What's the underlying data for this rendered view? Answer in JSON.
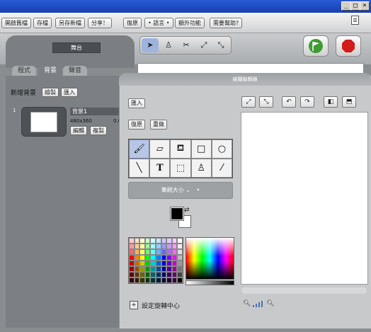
{
  "menubar": {
    "buttons": [
      "開啟舊檔",
      "存檔",
      "另存新檔",
      "分享！",
      "復原",
      "• 語言 •",
      "額外功能",
      "需要幫助?"
    ]
  },
  "stage": {
    "name": "舞台",
    "tabs": [
      "程式",
      "背景",
      "聲音"
    ],
    "selected_tab": "背景"
  },
  "backdrops": {
    "new_label": "新增背景",
    "paint_button": "繪製",
    "import_button": "匯入",
    "items": [
      {
        "index": "1",
        "name": "背景1",
        "size": "480x360",
        "extra": "0.0",
        "edit_button": "編輯",
        "copy_button": "複製"
      }
    ]
  },
  "paint_editor": {
    "title": "繪圖編輯器",
    "import_button": "匯入",
    "undo_button": "復原",
    "redo_button": "重做",
    "brush_size_label": "筆刷大小",
    "brush_size_value": "•",
    "set_rotation_center": "設定旋轉中心",
    "swatches": [
      "#ffcccc",
      "#ffe0cc",
      "#ffffcc",
      "#ccffcc",
      "#ccffff",
      "#cce0ff",
      "#ccccff",
      "#e0ccff",
      "#ffccff",
      "#ffffff",
      "#ff9999",
      "#ffcc99",
      "#ffff99",
      "#99ff99",
      "#99ffff",
      "#99ccff",
      "#9999ff",
      "#cc99ff",
      "#ff99ff",
      "#eeeeee",
      "#ff6666",
      "#ffb366",
      "#ffff66",
      "#66ff66",
      "#66ffff",
      "#66b3ff",
      "#6666ff",
      "#b366ff",
      "#ff66ff",
      "#dddddd",
      "#ff0000",
      "#ff8000",
      "#ffff00",
      "#00ff00",
      "#00ffff",
      "#0080ff",
      "#0000ff",
      "#8000ff",
      "#ff00ff",
      "#bbbbbb",
      "#cc0000",
      "#cc6600",
      "#cccc00",
      "#00cc00",
      "#00cccc",
      "#0066cc",
      "#0000cc",
      "#6600cc",
      "#cc00cc",
      "#999999",
      "#990000",
      "#994c00",
      "#999900",
      "#009900",
      "#009999",
      "#004c99",
      "#000099",
      "#4c0099",
      "#990099",
      "#777777",
      "#660000",
      "#663300",
      "#666600",
      "#006600",
      "#006666",
      "#003366",
      "#000066",
      "#330066",
      "#660066",
      "#444444",
      "#330000",
      "#331a00",
      "#333300",
      "#003300",
      "#003333",
      "#001a33",
      "#000033",
      "#1a0033",
      "#330033",
      "#000000"
    ],
    "foreground_color": "#000000",
    "background_color": "#ffffff"
  }
}
